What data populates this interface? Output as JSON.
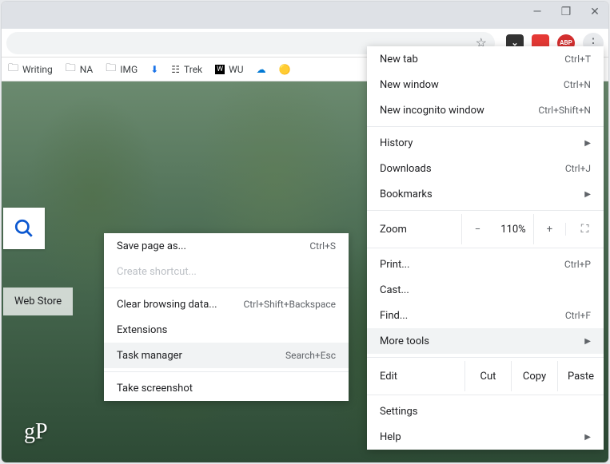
{
  "window_controls": {
    "minimize": "—",
    "restore": "❐",
    "close": "✕"
  },
  "extensions": {
    "pocket": {
      "color": "#333",
      "glyph": "⌄"
    },
    "red1": {
      "color": "#e53935",
      "glyph": ""
    },
    "abp": {
      "color": "#d32f2f",
      "glyph": "ABP"
    }
  },
  "bookmarks": [
    {
      "icon": "folder",
      "label": "Writing"
    },
    {
      "icon": "folder",
      "label": "NA"
    },
    {
      "icon": "folder",
      "label": "IMG"
    },
    {
      "icon": "download",
      "label": ""
    },
    {
      "icon": "trek",
      "label": "Trek"
    },
    {
      "icon": "wu",
      "label": "WU"
    },
    {
      "icon": "cloud",
      "label": ""
    },
    {
      "icon": "photos",
      "label": ""
    }
  ],
  "tiles": {
    "webstore": "Web Store"
  },
  "logo": "gP",
  "main_menu": {
    "new_tab": {
      "label": "New tab",
      "shortcut": "Ctrl+T"
    },
    "new_window": {
      "label": "New window",
      "shortcut": "Ctrl+N"
    },
    "new_incognito": {
      "label": "New incognito window",
      "shortcut": "Ctrl+Shift+N"
    },
    "history": {
      "label": "History"
    },
    "downloads": {
      "label": "Downloads",
      "shortcut": "Ctrl+J"
    },
    "bookmarks": {
      "label": "Bookmarks"
    },
    "zoom": {
      "label": "Zoom",
      "minus": "−",
      "pct": "110%",
      "plus": "+"
    },
    "print": {
      "label": "Print...",
      "shortcut": "Ctrl+P"
    },
    "cast": {
      "label": "Cast..."
    },
    "find": {
      "label": "Find...",
      "shortcut": "Ctrl+F"
    },
    "more_tools": {
      "label": "More tools"
    },
    "edit": {
      "label": "Edit",
      "cut": "Cut",
      "copy": "Copy",
      "paste": "Paste"
    },
    "settings": {
      "label": "Settings"
    },
    "help": {
      "label": "Help"
    }
  },
  "sub_menu": {
    "save_page": {
      "label": "Save page as...",
      "shortcut": "Ctrl+S"
    },
    "create_shortcut": {
      "label": "Create shortcut..."
    },
    "clear_browsing": {
      "label": "Clear browsing data...",
      "shortcut": "Ctrl+Shift+Backspace"
    },
    "extensions": {
      "label": "Extensions"
    },
    "task_manager": {
      "label": "Task manager",
      "shortcut": "Search+Esc"
    },
    "take_screenshot": {
      "label": "Take screenshot"
    }
  }
}
